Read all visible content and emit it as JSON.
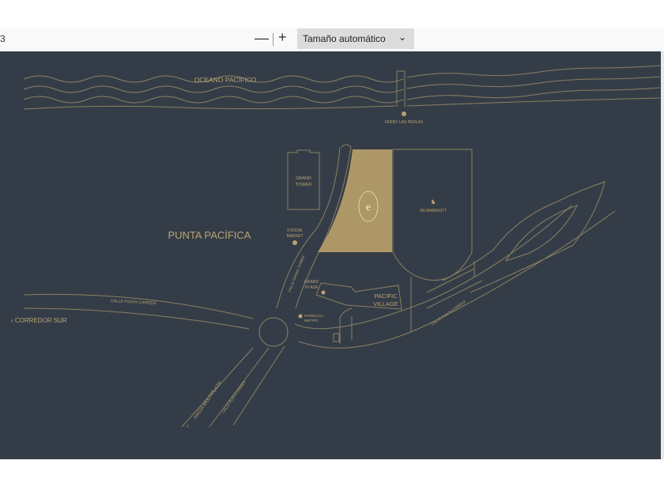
{
  "toolbar": {
    "page_indicator": "3",
    "zoom_out": "—",
    "zoom_in": "+",
    "zoom_value": "Tamaño automático",
    "chevron": "chevron-down-icon"
  },
  "map": {
    "colors": {
      "background": "#343d47",
      "lines": "#8c7f63",
      "gold": "#ae9767",
      "label": "#b9a272"
    },
    "ocean": "OCEANO PACÍFICO",
    "ferry": "FERRY LAS PERLAS",
    "grand_tower": [
      "GRAND",
      "TOWER"
    ],
    "foodie_market": [
      "FOODIE",
      "MARKET"
    ],
    "jw_marriott": "JW MARRIOTT",
    "punta_pacifica": "PUNTA PACÍFICA",
    "calle_grand_tower": "CALLE GRAND TOWER",
    "grand_plaza": [
      "GRAND",
      "PLAZA"
    ],
    "pacific_village": [
      "PACIFIC",
      "VILLAGE"
    ],
    "farmacia": [
      "FARMACIA",
      "METRO"
    ],
    "calle_chiriqui_left": "CALLE PUNTA CHIRIQUÍ",
    "calle_chiriqui_right": "CALLE PUNTA CHIRIQUÍ",
    "corredor_sur": "CORREDOR SUR",
    "hacia_multiplaza": "HACIA MULTIPLAZA",
    "calle_darien": "CALLE PUNTA DARIÉN",
    "logo_letter": "e"
  }
}
